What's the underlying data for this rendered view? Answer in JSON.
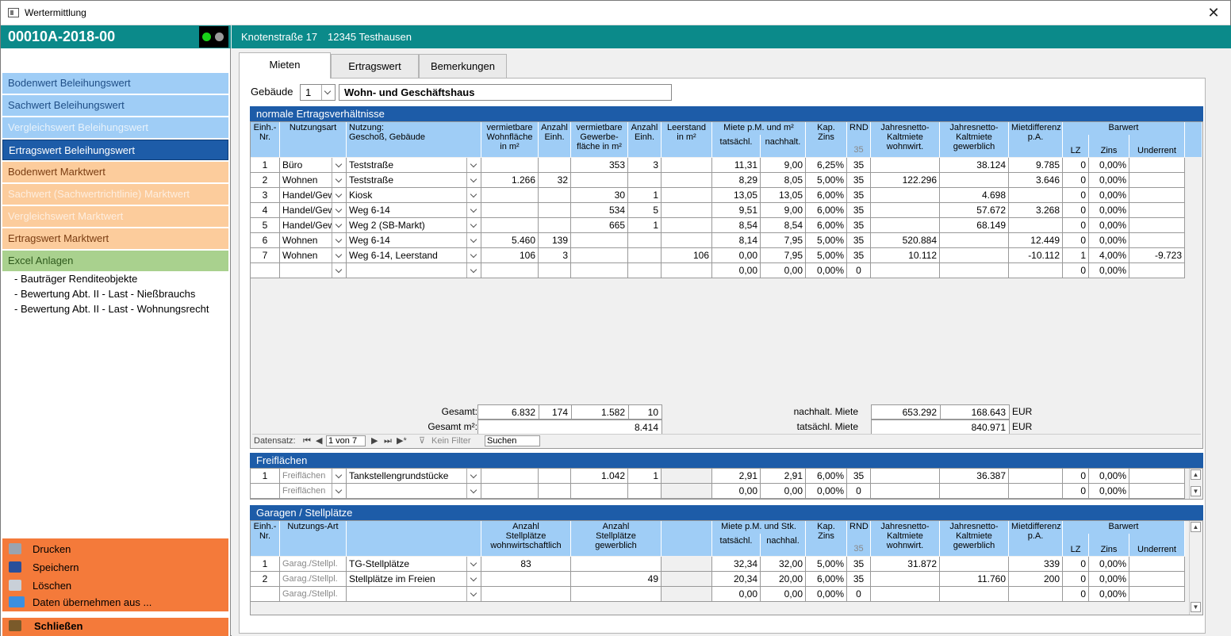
{
  "window": {
    "title": "Wertermittlung"
  },
  "case": {
    "id": "00010A-2018-00"
  },
  "address": {
    "street": "Knotenstraße 17",
    "city": "12345 Testhausen"
  },
  "nav": [
    {
      "label": "Bodenwert Beleihungswert",
      "style": "blue"
    },
    {
      "label": "Sachwert Beleihungswert",
      "style": "blue"
    },
    {
      "label": "Vergleichswert Beleihungswert",
      "style": "blue-dis"
    },
    {
      "label": "Ertragswert Beleihungswert",
      "style": "sel"
    },
    {
      "label": "Bodenwert Marktwert",
      "style": "orange"
    },
    {
      "label": "Sachwert (Sachwertrichtlinie) Marktwert",
      "style": "orange-dis"
    },
    {
      "label": "Vergleichswert Marktwert",
      "style": "orange-dis"
    },
    {
      "label": "Ertragswert Marktwert",
      "style": "orange"
    },
    {
      "label": "Excel Anlagen",
      "style": "green"
    }
  ],
  "sublinks": [
    "- Bauträger Renditeobjekte",
    "- Bewertung Abt. II - Last - Nießbrauchs",
    "- Bewertung Abt. II - Last - Wohnungsrecht"
  ],
  "actions": {
    "print": "Drucken",
    "save": "Speichern",
    "delete": "Löschen",
    "import": "Daten übernehmen aus ...",
    "close": "Schließen"
  },
  "tabs": [
    "Mieten",
    "Ertragswert",
    "Bemerkungen"
  ],
  "building": {
    "label": "Gebäude",
    "number": "1",
    "name": "Wohn- und Geschäftshaus"
  },
  "sec1": {
    "title": "normale Ertragsverhältnisse",
    "headers": {
      "nr": "Einh.-\nNr.",
      "art": "Nutzungsart",
      "nutz": "Nutzung:\nGeschoß, Gebäude",
      "wfl": "vermietbare\nWohnfläche\nin m²",
      "anzw": "Anzahl\nEinh.",
      "gfl": "vermietbare\nGewerbe-\nfläche in m²",
      "anzg": "Anzahl\nEinh.",
      "leer": "Leerstand\nin m²",
      "miete": "Miete p.M. und m²",
      "tats": "tatsächl.",
      "nach": "nachhalt.",
      "kap": "Kap.\nZins",
      "rnd": "RND",
      "rnd2": "35",
      "jnw": "Jahresnetto-\nKaltmiete\nwohnwirt.",
      "jng": "Jahresnetto-\nKaltmiete\ngewerblich",
      "md": "Mietdifferenz\np.A.",
      "bar": "Barwert",
      "lz": "LZ",
      "zins": "Zins",
      "under": "Underrent"
    },
    "rows": [
      [
        "1",
        "Büro",
        "Teststraße",
        "",
        "",
        "353",
        "3",
        "",
        "11,31",
        "9,00",
        "6,25%",
        "35",
        "",
        "38.124",
        "9.785",
        "0",
        "0,00%",
        ""
      ],
      [
        "2",
        "Wohnen",
        "Teststraße",
        "1.266",
        "32",
        "",
        "",
        "",
        "8,29",
        "8,05",
        "5,00%",
        "35",
        "122.296",
        "",
        "3.646",
        "0",
        "0,00%",
        ""
      ],
      [
        "3",
        "Handel/Gewe",
        "Kiosk",
        "",
        "",
        "30",
        "1",
        "",
        "13,05",
        "13,05",
        "6,00%",
        "35",
        "",
        "4.698",
        "",
        "0",
        "0,00%",
        ""
      ],
      [
        "4",
        "Handel/Gewe",
        "Weg 6-14",
        "",
        "",
        "534",
        "5",
        "",
        "9,51",
        "9,00",
        "6,00%",
        "35",
        "",
        "57.672",
        "3.268",
        "0",
        "0,00%",
        ""
      ],
      [
        "5",
        "Handel/Gewe",
        "Weg 2 (SB-Markt)",
        "",
        "",
        "665",
        "1",
        "",
        "8,54",
        "8,54",
        "6,00%",
        "35",
        "",
        "68.149",
        "",
        "0",
        "0,00%",
        ""
      ],
      [
        "6",
        "Wohnen",
        "Weg 6-14",
        "5.460",
        "139",
        "",
        "",
        "",
        "8,14",
        "7,95",
        "5,00%",
        "35",
        "520.884",
        "",
        "12.449",
        "0",
        "0,00%",
        ""
      ],
      [
        "7",
        "Wohnen",
        "Weg 6-14, Leerstand",
        "106",
        "3",
        "",
        "",
        "106",
        "0,00",
        "7,95",
        "5,00%",
        "35",
        "10.112",
        "",
        "-10.112",
        "1",
        "4,00%",
        "-9.723"
      ],
      [
        "",
        "",
        "",
        "",
        "",
        "",
        "",
        "",
        "0,00",
        "0,00",
        "0,00%",
        "0",
        "",
        "",
        "",
        "0",
        "0,00%",
        ""
      ]
    ],
    "totals": {
      "gesamt": "Gesamt:",
      "wfl": "6.832",
      "anzw": "174",
      "gfl": "1.582",
      "anzg": "10",
      "nachLbl": "nachhalt. Miete",
      "jnw": "653.292",
      "jng": "168.643",
      "eur1": "EUR",
      "gesamtm2": "Gesamt m²:",
      "sum": "8.414",
      "tatsLbl": "tatsächl. Miete",
      "tatsVal": "840.971",
      "eur2": "EUR"
    },
    "recnav": {
      "label": "Datensatz:",
      "pos": "1 von 7",
      "filter": "Kein Filter",
      "search": "Suchen"
    }
  },
  "sec2": {
    "title": "Freiflächen",
    "rows": [
      [
        "1",
        "Freiflächen",
        "Tankstellengrundstücke",
        "",
        "",
        "1.042",
        "1",
        "",
        "2,91",
        "2,91",
        "6,00%",
        "35",
        "",
        "36.387",
        "",
        "0",
        "0,00%",
        ""
      ],
      [
        "",
        "Freiflächen",
        "",
        "",
        "",
        "",
        "",
        "",
        "0,00",
        "0,00",
        "0,00%",
        "0",
        "",
        "",
        "",
        "0",
        "0,00%",
        ""
      ]
    ]
  },
  "sec3": {
    "title": "Garagen / Stellplätze",
    "headers": {
      "nr": "Einh.-\nNr.",
      "art": "Nutzungs-Art",
      "sw": "Anzahl\nStellplätze\nwohnwirtschaftlich",
      "sg": "Anzahl\nStellplätze\ngewerblich",
      "miete": "Miete p.M. und Stk.",
      "tats": "tatsächl.",
      "nach": "nachhal.",
      "kap": "Kap.\nZins",
      "rnd": "RND",
      "rnd2": "35",
      "jnw": "Jahresnetto-\nKaltmiete\nwohnwirt.",
      "jng": "Jahresnetto-\nKaltmiete\ngewerblich",
      "md": "Mietdifferenz\np.A.",
      "bar": "Barwert",
      "lz": "LZ",
      "zins": "Zins",
      "under": "Underrent"
    },
    "rows": [
      [
        "1",
        "Garag./Stellpl.",
        "TG-Stellplätze",
        "83",
        "",
        "32,34",
        "32,00",
        "5,00%",
        "35",
        "31.872",
        "",
        "339",
        "0",
        "0,00%",
        ""
      ],
      [
        "2",
        "Garag./Stellpl.",
        "Stellplätze im Freien",
        "",
        "49",
        "20,34",
        "20,00",
        "6,00%",
        "35",
        "",
        "11.760",
        "200",
        "0",
        "0,00%",
        ""
      ],
      [
        "",
        "Garag./Stellpl.",
        "",
        "",
        "",
        "0,00",
        "0,00",
        "0,00%",
        "0",
        "",
        "",
        "",
        "0",
        "0,00%",
        ""
      ]
    ]
  }
}
